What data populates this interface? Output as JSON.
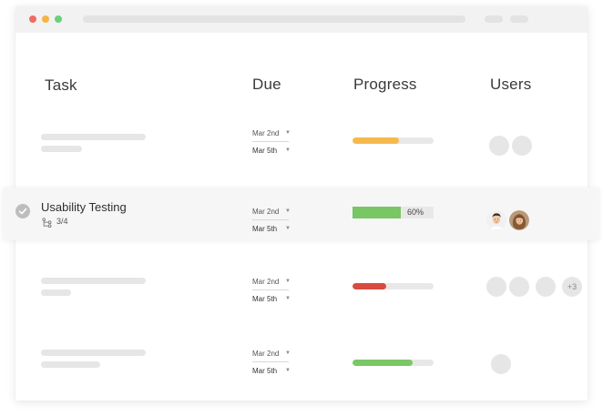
{
  "columns": {
    "task": "Task",
    "due": "Due",
    "progress": "Progress",
    "users": "Users"
  },
  "rows": [
    {
      "due_start": "Mar 2nd",
      "due_end": "Mar 5th",
      "progress": 0.57,
      "progress_color": "#f5b94d",
      "user_count": 2
    },
    {
      "title": "Usability Testing",
      "subtasks": "3/4",
      "due_start": "Mar 2nd",
      "due_end": "Mar 5th",
      "progress": 0.6,
      "progress_label": "60%",
      "progress_color": "#78c664",
      "users": [
        "avatar-man",
        "avatar-woman"
      ]
    },
    {
      "due_start": "Mar 2nd",
      "due_end": "Mar 5th",
      "progress": 0.42,
      "progress_color": "#d94b3f",
      "user_count": 3,
      "more_users": "+3"
    },
    {
      "due_start": "Mar 2nd",
      "due_end": "Mar 5th",
      "progress": 0.74,
      "progress_color": "#7bc765",
      "user_count": 1
    }
  ],
  "icons": {
    "check": "check-circle-icon",
    "subtask": "subtask-branch-icon",
    "caret": "caret-down-icon"
  }
}
